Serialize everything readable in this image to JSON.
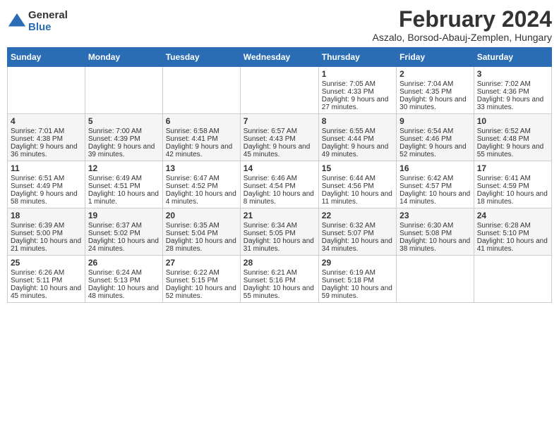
{
  "header": {
    "logo_general": "General",
    "logo_blue": "Blue",
    "main_title": "February 2024",
    "subtitle": "Aszalo, Borsod-Abauj-Zemplen, Hungary"
  },
  "days_of_week": [
    "Sunday",
    "Monday",
    "Tuesday",
    "Wednesday",
    "Thursday",
    "Friday",
    "Saturday"
  ],
  "weeks": [
    [
      {
        "day": "",
        "info": ""
      },
      {
        "day": "",
        "info": ""
      },
      {
        "day": "",
        "info": ""
      },
      {
        "day": "",
        "info": ""
      },
      {
        "day": "1",
        "info": "Sunrise: 7:05 AM\nSunset: 4:33 PM\nDaylight: 9 hours and 27 minutes."
      },
      {
        "day": "2",
        "info": "Sunrise: 7:04 AM\nSunset: 4:35 PM\nDaylight: 9 hours and 30 minutes."
      },
      {
        "day": "3",
        "info": "Sunrise: 7:02 AM\nSunset: 4:36 PM\nDaylight: 9 hours and 33 minutes."
      }
    ],
    [
      {
        "day": "4",
        "info": "Sunrise: 7:01 AM\nSunset: 4:38 PM\nDaylight: 9 hours and 36 minutes."
      },
      {
        "day": "5",
        "info": "Sunrise: 7:00 AM\nSunset: 4:39 PM\nDaylight: 9 hours and 39 minutes."
      },
      {
        "day": "6",
        "info": "Sunrise: 6:58 AM\nSunset: 4:41 PM\nDaylight: 9 hours and 42 minutes."
      },
      {
        "day": "7",
        "info": "Sunrise: 6:57 AM\nSunset: 4:43 PM\nDaylight: 9 hours and 45 minutes."
      },
      {
        "day": "8",
        "info": "Sunrise: 6:55 AM\nSunset: 4:44 PM\nDaylight: 9 hours and 49 minutes."
      },
      {
        "day": "9",
        "info": "Sunrise: 6:54 AM\nSunset: 4:46 PM\nDaylight: 9 hours and 52 minutes."
      },
      {
        "day": "10",
        "info": "Sunrise: 6:52 AM\nSunset: 4:48 PM\nDaylight: 9 hours and 55 minutes."
      }
    ],
    [
      {
        "day": "11",
        "info": "Sunrise: 6:51 AM\nSunset: 4:49 PM\nDaylight: 9 hours and 58 minutes."
      },
      {
        "day": "12",
        "info": "Sunrise: 6:49 AM\nSunset: 4:51 PM\nDaylight: 10 hours and 1 minute."
      },
      {
        "day": "13",
        "info": "Sunrise: 6:47 AM\nSunset: 4:52 PM\nDaylight: 10 hours and 4 minutes."
      },
      {
        "day": "14",
        "info": "Sunrise: 6:46 AM\nSunset: 4:54 PM\nDaylight: 10 hours and 8 minutes."
      },
      {
        "day": "15",
        "info": "Sunrise: 6:44 AM\nSunset: 4:56 PM\nDaylight: 10 hours and 11 minutes."
      },
      {
        "day": "16",
        "info": "Sunrise: 6:42 AM\nSunset: 4:57 PM\nDaylight: 10 hours and 14 minutes."
      },
      {
        "day": "17",
        "info": "Sunrise: 6:41 AM\nSunset: 4:59 PM\nDaylight: 10 hours and 18 minutes."
      }
    ],
    [
      {
        "day": "18",
        "info": "Sunrise: 6:39 AM\nSunset: 5:00 PM\nDaylight: 10 hours and 21 minutes."
      },
      {
        "day": "19",
        "info": "Sunrise: 6:37 AM\nSunset: 5:02 PM\nDaylight: 10 hours and 24 minutes."
      },
      {
        "day": "20",
        "info": "Sunrise: 6:35 AM\nSunset: 5:04 PM\nDaylight: 10 hours and 28 minutes."
      },
      {
        "day": "21",
        "info": "Sunrise: 6:34 AM\nSunset: 5:05 PM\nDaylight: 10 hours and 31 minutes."
      },
      {
        "day": "22",
        "info": "Sunrise: 6:32 AM\nSunset: 5:07 PM\nDaylight: 10 hours and 34 minutes."
      },
      {
        "day": "23",
        "info": "Sunrise: 6:30 AM\nSunset: 5:08 PM\nDaylight: 10 hours and 38 minutes."
      },
      {
        "day": "24",
        "info": "Sunrise: 6:28 AM\nSunset: 5:10 PM\nDaylight: 10 hours and 41 minutes."
      }
    ],
    [
      {
        "day": "25",
        "info": "Sunrise: 6:26 AM\nSunset: 5:11 PM\nDaylight: 10 hours and 45 minutes."
      },
      {
        "day": "26",
        "info": "Sunrise: 6:24 AM\nSunset: 5:13 PM\nDaylight: 10 hours and 48 minutes."
      },
      {
        "day": "27",
        "info": "Sunrise: 6:22 AM\nSunset: 5:15 PM\nDaylight: 10 hours and 52 minutes."
      },
      {
        "day": "28",
        "info": "Sunrise: 6:21 AM\nSunset: 5:16 PM\nDaylight: 10 hours and 55 minutes."
      },
      {
        "day": "29",
        "info": "Sunrise: 6:19 AM\nSunset: 5:18 PM\nDaylight: 10 hours and 59 minutes."
      },
      {
        "day": "",
        "info": ""
      },
      {
        "day": "",
        "info": ""
      }
    ]
  ]
}
